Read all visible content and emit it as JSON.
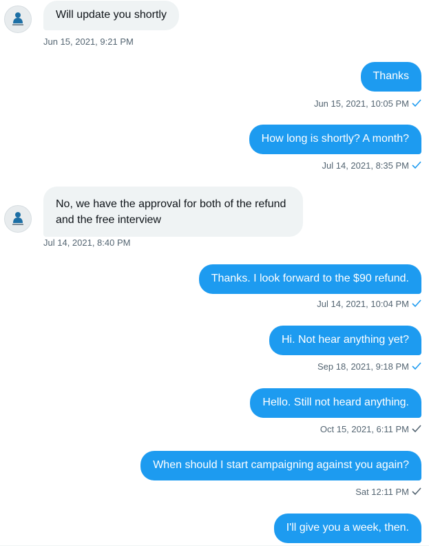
{
  "colors": {
    "outgoing_bubble": "#1d9bf0",
    "incoming_bubble": "#eff3f4",
    "meta_text": "#536471",
    "read_check": "#1d9bf0",
    "sent_check": "#536471"
  },
  "messages": [
    {
      "direction": "incoming",
      "text": "Will update you shortly",
      "time": "Jun 15, 2021, 9:21 PM",
      "avatar_icon": "user-avatar-icon"
    },
    {
      "direction": "outgoing",
      "text": "Thanks",
      "time": "Jun 15, 2021, 10:05 PM",
      "status_icon": "read-check-icon"
    },
    {
      "direction": "outgoing",
      "text": "How long is shortly? A month?",
      "time": "Jul 14, 2021, 8:35 PM",
      "status_icon": "read-check-icon"
    },
    {
      "direction": "incoming",
      "text": "No, we have the approval for both of the refund and the free interview",
      "time": "Jul 14, 2021, 8:40 PM",
      "avatar_icon": "user-avatar-icon"
    },
    {
      "direction": "outgoing",
      "text": "Thanks. I look forward to the $90 refund.",
      "time": "Jul 14, 2021, 10:04 PM",
      "status_icon": "read-check-icon"
    },
    {
      "direction": "outgoing",
      "text": "Hi. Not hear anything yet?",
      "time": "Sep 18, 2021, 9:18 PM",
      "status_icon": "read-check-icon"
    },
    {
      "direction": "outgoing",
      "text": "Hello. Still not heard anything.",
      "time": "Oct 15, 2021, 6:11 PM",
      "status_icon": "sent-check-icon"
    },
    {
      "direction": "outgoing",
      "text": "When should I start campaigning against you again?",
      "time": "Sat 12:11 PM",
      "status_icon": "sent-check-icon"
    },
    {
      "direction": "outgoing",
      "text": "I'll give you a week, then."
    }
  ]
}
